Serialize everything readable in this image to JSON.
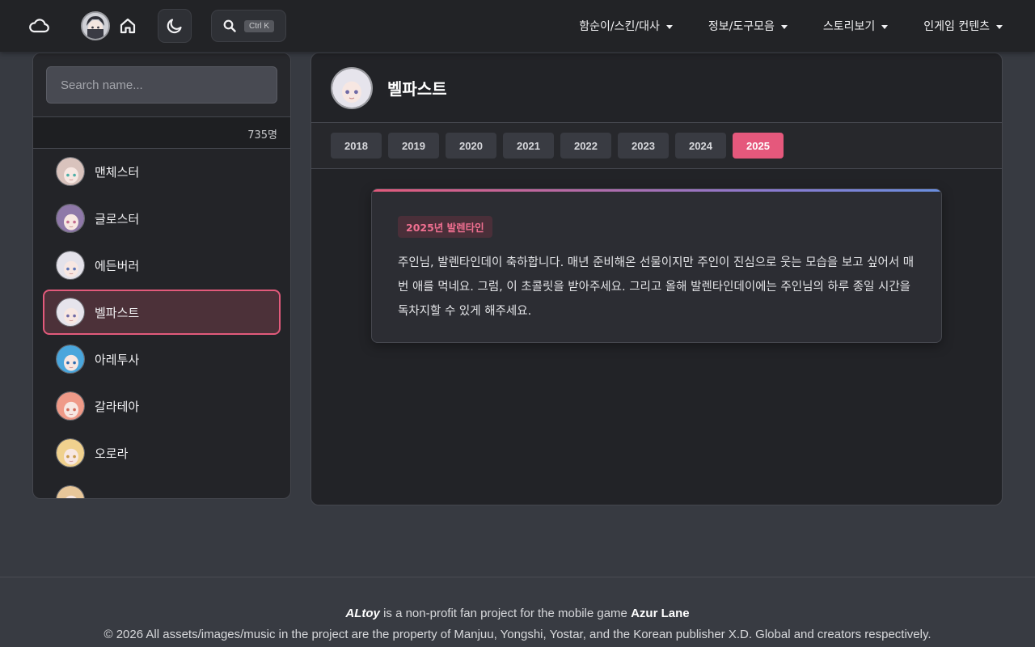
{
  "nav": {
    "menu": [
      {
        "label": "함순이/스킨/대사"
      },
      {
        "label": "정보/도구모음"
      },
      {
        "label": "스토리보기"
      },
      {
        "label": "인게임 컨텐츠"
      }
    ],
    "search_shortcut": "Ctrl K"
  },
  "sidebar": {
    "search_placeholder": "Search name...",
    "count": "735명",
    "items": [
      {
        "name": "맨체스터",
        "hair": "#d9c3bd",
        "eye": "#4fb0a8"
      },
      {
        "name": "글로스터",
        "hair": "#8e78a8",
        "eye": "#c46c8f"
      },
      {
        "name": "에든버러",
        "hair": "#e4e2ea",
        "eye": "#5e76b8"
      },
      {
        "name": "벨파스트",
        "hair": "#e6e4ec",
        "eye": "#6f6aa6",
        "selected": true
      },
      {
        "name": "아레투사",
        "hair": "#4aa6dc",
        "eye": "#2f6cb0"
      },
      {
        "name": "갈라테아",
        "hair": "#ef9a88",
        "eye": "#d06a5a"
      },
      {
        "name": "오로라",
        "hair": "#f0d18e",
        "eye": "#c89a4a"
      }
    ]
  },
  "main": {
    "title": "벨파스트",
    "years": [
      "2018",
      "2019",
      "2020",
      "2021",
      "2022",
      "2023",
      "2024",
      "2025"
    ],
    "active_year": "2025",
    "card": {
      "badge": "2025년 발렌타인",
      "text": "주인님, 발렌타인데이 축하합니다. 매년 준비해온 선물이지만 주인이 진심으로 웃는 모습을 보고 싶어서 매번 애를 먹네요. 그럼, 이 초콜릿을 받아주세요. 그리고 올해 발렌타인데이에는 주인님의 하루 종일 시간을 독차지할 수 있게 해주세요."
    }
  },
  "footer": {
    "brand": "ALtoy",
    "line1_mid": " is a non-profit fan project for the mobile game ",
    "game": "Azur Lane",
    "line2": "© 2026 All assets/images/music in the project are the property of Manjuu, Yongshi, Yostar, and the Korean publisher X.D. Global and creators respectively."
  },
  "colors": {
    "accent": "#e5587c",
    "nav_bg": "#222326",
    "page_bg": "#373a41"
  },
  "icons": {
    "cloud": "cloud-icon",
    "home": "home-icon",
    "theme": "moon-icon",
    "search": "search-icon"
  }
}
